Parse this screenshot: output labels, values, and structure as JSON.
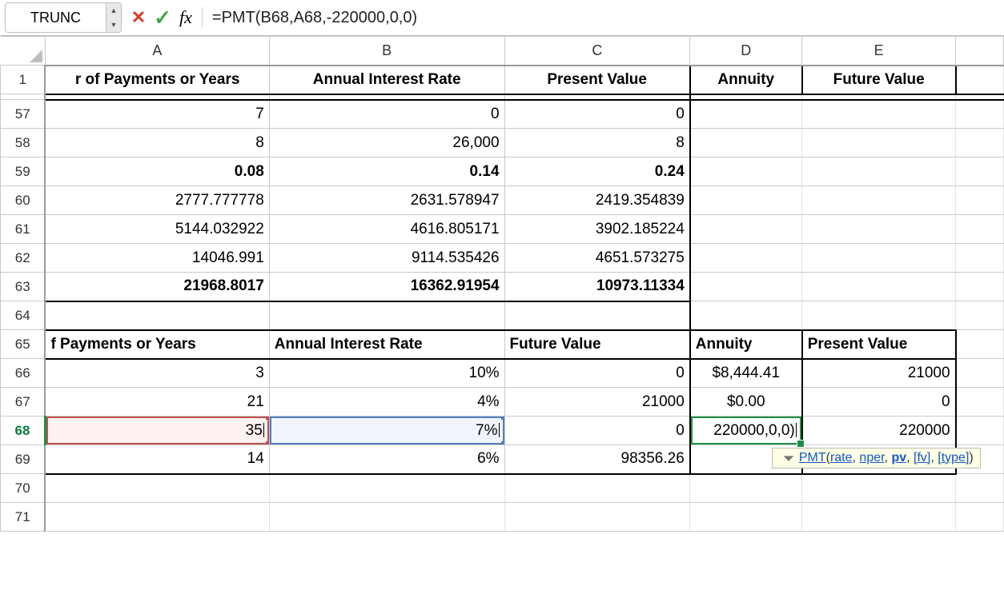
{
  "nameBox": {
    "value": "TRUNC"
  },
  "formulaBar": {
    "cancel_glyph": "✕",
    "confirm_glyph": "✓",
    "fx_label": "fx",
    "formula": "=PMT(B68,A68,-220000,0,0)"
  },
  "columns": [
    "A",
    "B",
    "C",
    "D",
    "E"
  ],
  "headerRow": {
    "num": "1",
    "A": "r of Payments or Years",
    "B": "Annual Interest Rate",
    "C": "Present Value",
    "D": "Annuity",
    "E": "Future Value"
  },
  "rows": [
    {
      "num": "57",
      "A": "7",
      "B": "0",
      "C": "0",
      "D": "",
      "E": ""
    },
    {
      "num": "58",
      "A": "8",
      "B": "26,000",
      "C": "8",
      "D": "",
      "E": ""
    },
    {
      "num": "59",
      "A": "0.08",
      "B": "0.14",
      "C": "0.24",
      "D": "",
      "E": "",
      "bold": true
    },
    {
      "num": "60",
      "A": "2777.777778",
      "B": "2631.578947",
      "C": "2419.354839",
      "D": "",
      "E": ""
    },
    {
      "num": "61",
      "A": "5144.032922",
      "B": "4616.805171",
      "C": "3902.185224",
      "D": "",
      "E": ""
    },
    {
      "num": "62",
      "A": "14046.991",
      "B": "9114.535426",
      "C": "4651.573275",
      "D": "",
      "E": ""
    },
    {
      "num": "63",
      "A": "21968.8017",
      "B": "16362.91954",
      "C": "10973.11334",
      "D": "",
      "E": "",
      "bold": true,
      "bb": true
    },
    {
      "num": "64",
      "A": "",
      "B": "",
      "C": "",
      "D": "",
      "E": ""
    }
  ],
  "header65": {
    "num": "65",
    "A": "f Payments or Years",
    "B": "Annual Interest Rate",
    "C": "Future Value",
    "D": "Annuity",
    "E": "Present Value"
  },
  "row66": {
    "num": "66",
    "A": "3",
    "B": "10%",
    "C": "0",
    "D": "$8,444.41",
    "E": "21000"
  },
  "row67": {
    "num": "67",
    "A": "21",
    "B": "4%",
    "C": "21000",
    "D": "$0.00",
    "E": "0"
  },
  "row68": {
    "num": "68",
    "A": "35",
    "B": "7%",
    "C": "0",
    "D": "220000,0,0)",
    "E": "220000"
  },
  "row69": {
    "num": "69",
    "A": "14",
    "B": "6%",
    "C": "98356.26",
    "D": "",
    "E": ""
  },
  "row70": {
    "num": "70"
  },
  "row71": {
    "num": "71"
  },
  "tooltip": {
    "fn": "PMT",
    "args": [
      "rate",
      "nper",
      "pv",
      "[fv]",
      "[type]"
    ],
    "bold_index": 2
  },
  "colors": {
    "cancel": "#d83b2b",
    "confirm": "#3fa648"
  },
  "icons": {
    "dropdown": "dropdown-icon"
  }
}
